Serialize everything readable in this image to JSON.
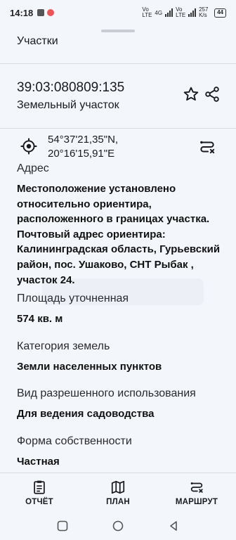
{
  "status_bar": {
    "time": "14:18",
    "net_label_1": "Vo LTE",
    "net_label_2": "4G",
    "net_label_3": "Vo LTE",
    "speed": "257 K/s",
    "battery": "44"
  },
  "header": {
    "title": "Участки"
  },
  "parcel": {
    "cadastral_number": "39:03:080809:135",
    "type": "Земельный участок",
    "coords_lat": "54°37'21,35\"N,",
    "coords_lon": "20°16'15,91\"E"
  },
  "sections": [
    {
      "label": "Адрес",
      "value": "Местоположение установлено относительно ориентира, расположенного в границах участка. Почтовый адрес ориентира: Калининградская область, Гурьевский район, пос. Ушаково, СНТ Рыбак , участок 24."
    },
    {
      "label": "Площадь уточненная",
      "value": "574 кв. м"
    },
    {
      "label": "Категория земель",
      "value": "Земли населенных пунктов"
    },
    {
      "label": "Вид разрешенного использования",
      "value": "Для ведения садоводства"
    },
    {
      "label": "Форма собственности",
      "value": "Частная"
    }
  ],
  "bottom_bar": {
    "report_label": "ОТЧЁТ",
    "plan_label": "ПЛАН",
    "route_label": "МАРШРУТ"
  },
  "icons": {
    "favorite": "star-icon",
    "share": "share-icon",
    "locate": "crosshair-icon",
    "route": "route-icon",
    "report": "clipboard-icon",
    "plan": "map-icon",
    "route_bottom": "route-icon"
  },
  "colors": {
    "background": "#f3f6fb",
    "text": "#1b1b1f",
    "divider": "#d9dce1"
  }
}
